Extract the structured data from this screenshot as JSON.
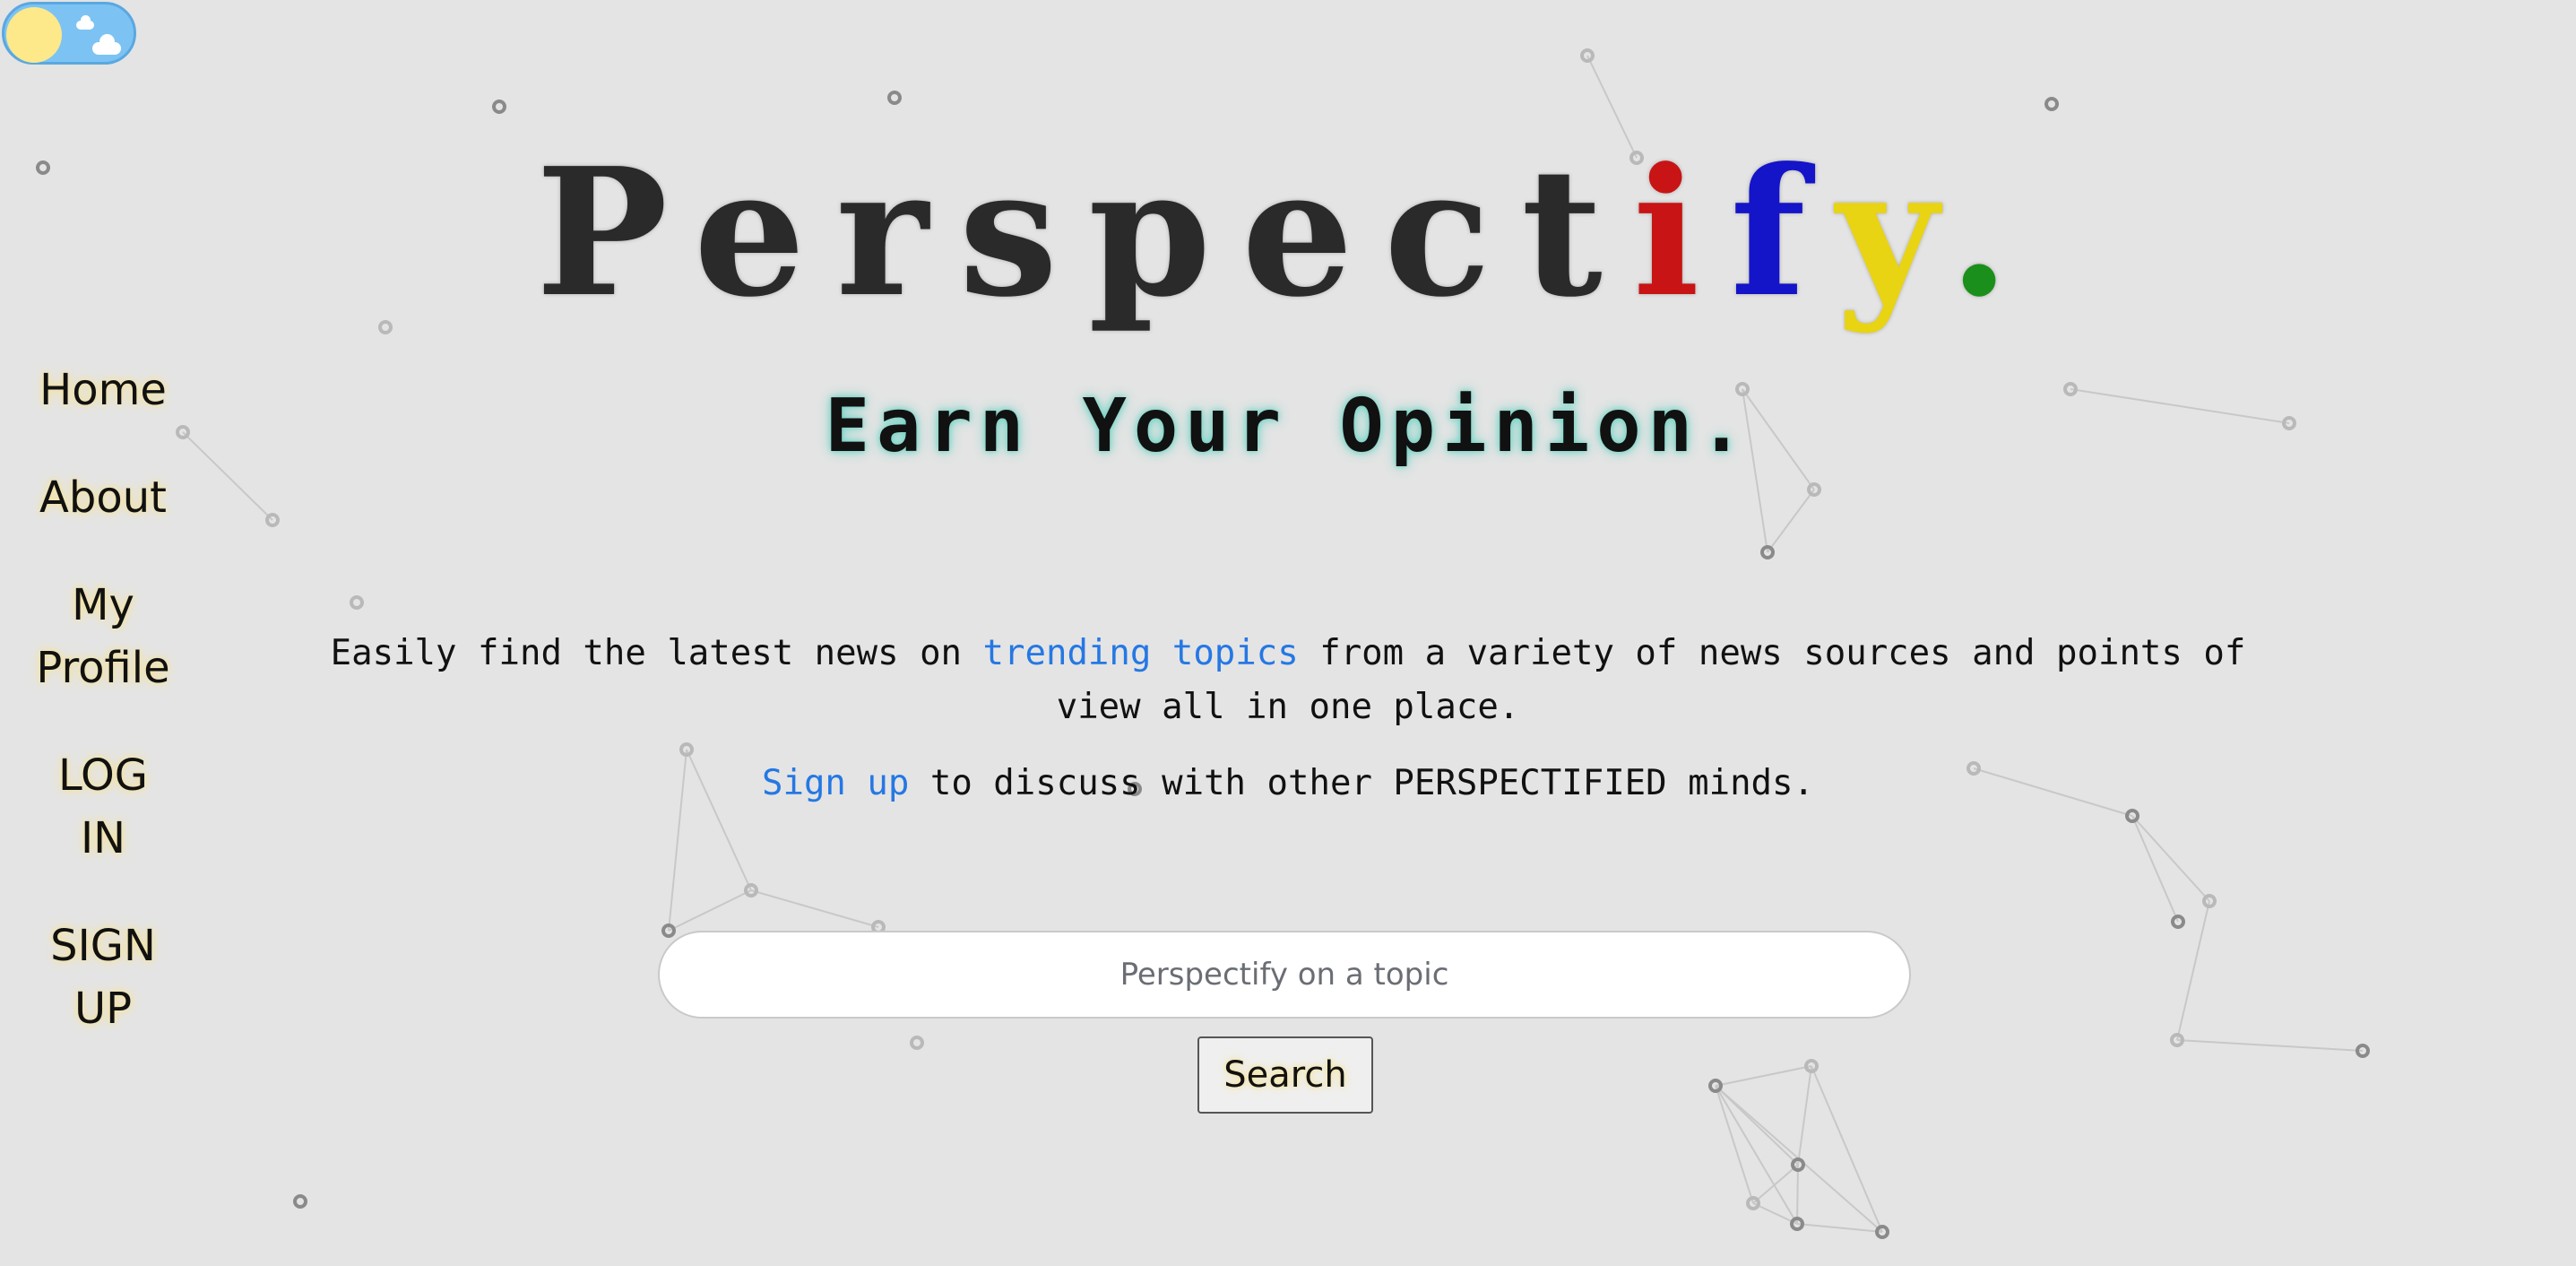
{
  "theme_toggle": {
    "icon": "sun-with-clouds-icon",
    "mode": "light"
  },
  "nav": {
    "home": "Home",
    "about": "About",
    "profile": "My\nProfile",
    "login": "LOG\nIN",
    "signup": "SIGN\nUP"
  },
  "logo": {
    "prefix": "Perspect",
    "i": "i",
    "f": "f",
    "y": "y",
    "dot": "."
  },
  "tagline": "Earn Your Opinion.",
  "intro": {
    "before": "Easily find the latest news on ",
    "link": "trending topics",
    "after": " from a variety of news sources and points of view all in one place."
  },
  "signup_line": {
    "link": "Sign up",
    "after": " to discuss with other PERSPECTIFIED minds."
  },
  "search": {
    "placeholder": "Perspectify on a topic",
    "value": "",
    "button": "Search"
  },
  "colors": {
    "background": "#e4e4e4",
    "link": "#2578e3",
    "logo_i": "#c81414",
    "logo_f": "#1414c8",
    "logo_y": "#e8d412",
    "logo_dot": "#1b8f1b"
  }
}
